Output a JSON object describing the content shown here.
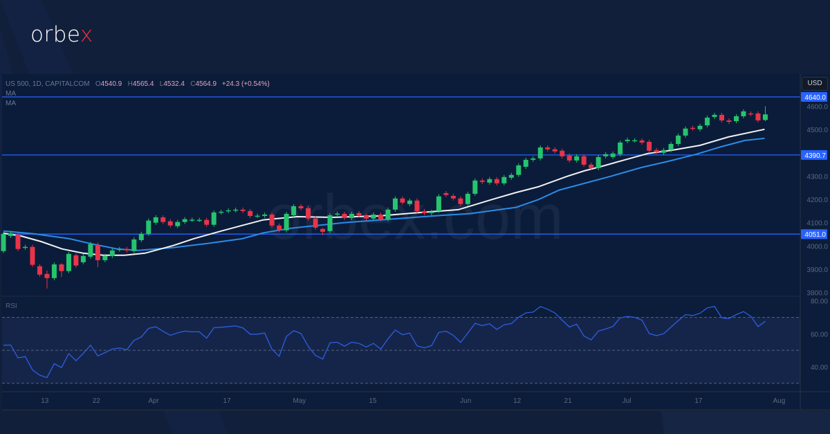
{
  "brand": {
    "logo_main": "orbe",
    "logo_accent": "x",
    "watermark": "orbex.com"
  },
  "header": {
    "symbol": "US 500, 1D, CAPITALCOM",
    "o_label": "O",
    "open": "4540.9",
    "h_label": "H",
    "high": "4565.4",
    "l_label": "L",
    "low": "4532.4",
    "c_label": "C",
    "close": "4564.9",
    "change": "+24.3 (+0.54%)",
    "ma1": "MA",
    "ma2": "MA"
  },
  "currency_button": "USD",
  "rsi_label": "RSI",
  "colors": {
    "up": "#26c46e",
    "down": "#e8344a",
    "level": "#2962ff",
    "ma_fast": "#f2f2f2",
    "ma_slow": "#2a8ce8",
    "rsi": "#2e5ee0"
  },
  "chart_data": {
    "type": "candlestick",
    "title": "US 500, 1D, CAPITALCOM",
    "price_axis": {
      "ylim": [
        3770,
        4665
      ],
      "ticks": [
        "3800.0",
        "3900.0",
        "4000.0",
        "4100.0",
        "4200.0",
        "4300.0",
        "4500.0",
        "4600.0"
      ]
    },
    "levels": [
      {
        "value": 4640.0,
        "label": "4640.0"
      },
      {
        "value": 4390.7,
        "label": "4390.7"
      },
      {
        "value": 4051.0,
        "label": "4051.0"
      }
    ],
    "x_ticks": [
      {
        "i": 5.7,
        "label": "13"
      },
      {
        "i": 12.8,
        "label": "22"
      },
      {
        "i": 20.7,
        "label": "Apr"
      },
      {
        "i": 30.8,
        "label": "17"
      },
      {
        "i": 40.8,
        "label": "May"
      },
      {
        "i": 50.9,
        "label": "15"
      },
      {
        "i": 63.7,
        "label": "Jun"
      },
      {
        "i": 70.8,
        "label": "12"
      },
      {
        "i": 77.8,
        "label": "21"
      },
      {
        "i": 85.9,
        "label": "Jul"
      },
      {
        "i": 95.8,
        "label": "17"
      },
      {
        "i": 106.9,
        "label": "Aug"
      }
    ],
    "candles_oc": [
      [
        3978,
        4052
      ],
      [
        4043,
        4055
      ],
      [
        4049,
        3987
      ],
      [
        3993,
        3996
      ],
      [
        3996,
        3919
      ],
      [
        3913,
        3877
      ],
      [
        3880,
        3862
      ],
      [
        3862,
        3921
      ],
      [
        3921,
        3892
      ],
      [
        3892,
        3966
      ],
      [
        3960,
        3916
      ],
      [
        3930,
        3957
      ],
      [
        3954,
        4008
      ],
      [
        4005,
        3939
      ],
      [
        3939,
        3957
      ],
      [
        3957,
        3981
      ],
      [
        3984,
        3987
      ],
      [
        3987,
        3981
      ],
      [
        3978,
        4028
      ],
      [
        4025,
        4052
      ],
      [
        4052,
        4109
      ],
      [
        4100,
        4123
      ],
      [
        4123,
        4103
      ],
      [
        4106,
        4088
      ],
      [
        4085,
        4103
      ],
      [
        4103,
        4115
      ],
      [
        4112,
        4113
      ],
      [
        4112,
        4112
      ],
      [
        4112,
        4091
      ],
      [
        4091,
        4144
      ],
      [
        4144,
        4147
      ],
      [
        4150,
        4153
      ],
      [
        4153,
        4156
      ],
      [
        4156,
        4150
      ],
      [
        4150,
        4129
      ],
      [
        4129,
        4130
      ],
      [
        4129,
        4135
      ],
      [
        4135,
        4088
      ],
      [
        4088,
        4067
      ],
      [
        4067,
        4138
      ],
      [
        4132,
        4171
      ],
      [
        4171,
        4162
      ],
      [
        4162,
        4118
      ],
      [
        4118,
        4079
      ],
      [
        4073,
        4061
      ],
      [
        4064,
        4132
      ],
      [
        4138,
        4139
      ],
      [
        4138,
        4120
      ],
      [
        4120,
        4138
      ],
      [
        4141,
        4132
      ],
      [
        4129,
        4118
      ],
      [
        4118,
        4135
      ],
      [
        4135,
        4115
      ],
      [
        4115,
        4156
      ],
      [
        4156,
        4204
      ],
      [
        4204,
        4186
      ],
      [
        4180,
        4195
      ],
      [
        4195,
        4150
      ],
      [
        4150,
        4141
      ],
      [
        4141,
        4147
      ],
      [
        4150,
        4213
      ],
      [
        4227,
        4219
      ],
      [
        4215,
        4204
      ],
      [
        4204,
        4180
      ],
      [
        4180,
        4224
      ],
      [
        4224,
        4281
      ],
      [
        4281,
        4275
      ],
      [
        4272,
        4287
      ],
      [
        4287,
        4269
      ],
      [
        4269,
        4296
      ],
      [
        4293,
        4305
      ],
      [
        4305,
        4346
      ],
      [
        4340,
        4370
      ],
      [
        4370,
        4376
      ],
      [
        4376,
        4423
      ],
      [
        4423,
        4415
      ],
      [
        4415,
        4406
      ],
      [
        4409,
        4385
      ],
      [
        4388,
        4367
      ],
      [
        4367,
        4385
      ],
      [
        4385,
        4349
      ],
      [
        4349,
        4334
      ],
      [
        4334,
        4382
      ],
      [
        4385,
        4394
      ],
      [
        4382,
        4397
      ],
      [
        4394,
        4444
      ],
      [
        4450,
        4456
      ],
      [
        4453,
        4454
      ],
      [
        4453,
        4444
      ],
      [
        4447,
        4409
      ],
      [
        4412,
        4403
      ],
      [
        4400,
        4412
      ],
      [
        4412,
        4438
      ],
      [
        4438,
        4474
      ],
      [
        4474,
        4504
      ],
      [
        4507,
        4504
      ],
      [
        4501,
        4516
      ],
      [
        4518,
        4551
      ],
      [
        4554,
        4563
      ],
      [
        4563,
        4539
      ],
      [
        4539,
        4533
      ],
      [
        4536,
        4557
      ],
      [
        4557,
        4578
      ],
      [
        4569,
        4566
      ],
      [
        4569,
        4539
      ],
      [
        4540.9,
        4564.9
      ]
    ],
    "wick_extents": {
      "default": 9,
      "big": {
        "6": [
          15,
          45
        ],
        "8": [
          5,
          25
        ],
        "13": [
          10,
          30
        ],
        "44": [
          5,
          15
        ],
        "105": [
          35,
          5
        ]
      }
    },
    "ma_fast": [
      [
        0,
        4055
      ],
      [
        2.4,
        4043
      ],
      [
        5.2,
        4019
      ],
      [
        8.1,
        3987
      ],
      [
        11,
        3969
      ],
      [
        13.8,
        3960
      ],
      [
        16.7,
        3960
      ],
      [
        19.5,
        3969
      ],
      [
        23.4,
        4002
      ],
      [
        26.2,
        4031
      ],
      [
        30,
        4064
      ],
      [
        32.9,
        4088
      ],
      [
        35.8,
        4112
      ],
      [
        40.5,
        4126
      ],
      [
        45.3,
        4123
      ],
      [
        51.7,
        4129
      ],
      [
        56.4,
        4141
      ],
      [
        62.7,
        4156
      ],
      [
        67.5,
        4201
      ],
      [
        70.7,
        4230
      ],
      [
        73.7,
        4254
      ],
      [
        77.7,
        4299
      ],
      [
        80,
        4322
      ],
      [
        82.6,
        4343
      ],
      [
        85.3,
        4367
      ],
      [
        88.8,
        4397
      ],
      [
        92.3,
        4412
      ],
      [
        96,
        4432
      ],
      [
        99.9,
        4468
      ],
      [
        104.9,
        4501
      ]
    ],
    "ma_slow": [
      [
        0,
        4064
      ],
      [
        4.3,
        4052
      ],
      [
        9.1,
        4031
      ],
      [
        11.9,
        4011
      ],
      [
        15.7,
        3987
      ],
      [
        18.6,
        3981
      ],
      [
        23.4,
        3993
      ],
      [
        28.1,
        4011
      ],
      [
        32.9,
        4031
      ],
      [
        35.8,
        4056
      ],
      [
        39.6,
        4076
      ],
      [
        46.9,
        4100
      ],
      [
        52.9,
        4114
      ],
      [
        59.2,
        4129
      ],
      [
        64.3,
        4139
      ],
      [
        70.7,
        4166
      ],
      [
        73.7,
        4199
      ],
      [
        76.6,
        4240
      ],
      [
        83.7,
        4299
      ],
      [
        87.9,
        4337
      ],
      [
        91.7,
        4364
      ],
      [
        95.5,
        4394
      ],
      [
        98.9,
        4426
      ],
      [
        102.2,
        4453
      ],
      [
        104.9,
        4462
      ]
    ],
    "rsi": {
      "ylim": [
        25,
        83
      ],
      "ticks": [
        "80.00",
        "60.00",
        "40.00"
      ],
      "bands": [
        70,
        50,
        30
      ],
      "values": [
        53.1,
        53.2,
        45.4,
        46.2,
        38.1,
        34.9,
        33.4,
        41.9,
        39.5,
        48.0,
        43.7,
        48.2,
        53.1,
        46.6,
        48.6,
        50.8,
        51.4,
        50.3,
        56.0,
        58.1,
        63.3,
        64.3,
        61.5,
        59.1,
        60.6,
        61.7,
        61.2,
        61.2,
        57.4,
        63.7,
        64.0,
        64.4,
        64.8,
        63.6,
        59.8,
        59.8,
        60.5,
        50.7,
        46.4,
        58.4,
        61.9,
        60.2,
        52.4,
        46.9,
        44.7,
        54.6,
        54.9,
        52.5,
        54.9,
        54.2,
        52.0,
        54.2,
        50.7,
        57.0,
        62.3,
        59.5,
        60.5,
        52.7,
        51.5,
        52.8,
        60.9,
        61.6,
        59.1,
        54.8,
        60.5,
        66.4,
        65.0,
        66.1,
        62.7,
        65.5,
        66.2,
        70.1,
        72.7,
        73.2,
        76.6,
        74.9,
        72.7,
        68.3,
        64.1,
        65.9,
        58.7,
        56.4,
        61.7,
        63.0,
        64.5,
        69.7,
        70.6,
        70.0,
        68.3,
        60.2,
        58.9,
        60.1,
        64.1,
        68.0,
        71.7,
        71.1,
        72.5,
        75.7,
        76.7,
        69.7,
        69.3,
        71.7,
        73.5,
        70.7,
        64.4,
        67.6
      ]
    }
  }
}
